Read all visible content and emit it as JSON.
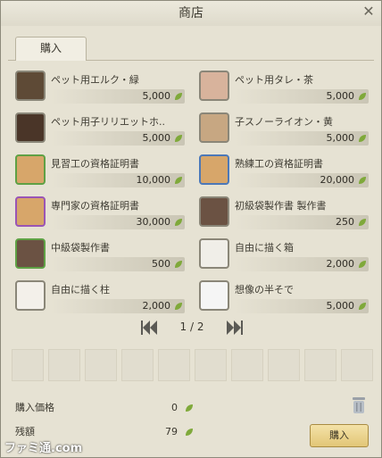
{
  "window": {
    "title": "商店"
  },
  "tabs": [
    {
      "label": "購入"
    }
  ],
  "items": [
    {
      "name": "ペット用エルク・緑",
      "price": "5,000"
    },
    {
      "name": "ペット用タレ・茶",
      "price": "5,000"
    },
    {
      "name": "ペット用子リリエットホ..",
      "price": "5,000"
    },
    {
      "name": "子スノーライオン・黄",
      "price": "5,000"
    },
    {
      "name": "見習工の資格証明書",
      "price": "10,000"
    },
    {
      "name": "熟練工の資格証明書",
      "price": "20,000"
    },
    {
      "name": "専門家の資格証明書",
      "price": "30,000"
    },
    {
      "name": "初級袋製作書 製作書",
      "price": "250"
    },
    {
      "name": "中級袋製作書",
      "price": "500"
    },
    {
      "name": "自由に描く箱",
      "price": "2,000"
    },
    {
      "name": "自由に描く柱",
      "price": "2,000"
    },
    {
      "name": "想像の半そで",
      "price": "5,000"
    }
  ],
  "pager": {
    "text": "1 / 2"
  },
  "totals": {
    "purchase_label": "購入価格",
    "purchase_value": "0",
    "balance_label": "残額",
    "balance_value": "79"
  },
  "buy_button": {
    "label": "購入"
  },
  "watermark": {
    "text": "ファミ通.com"
  },
  "colors": {
    "accent": "#7fa93a",
    "button": "#e2c677"
  }
}
